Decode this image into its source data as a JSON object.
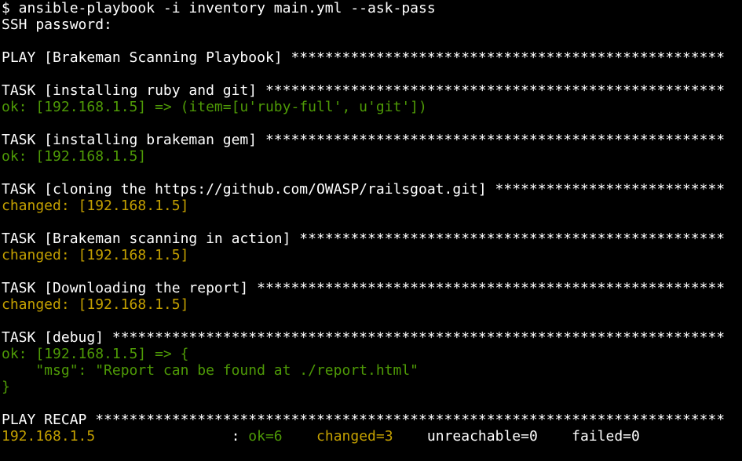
{
  "colors": {
    "background": "#000000",
    "default_text": "#ffffff",
    "ok": "#4e9a06",
    "changed": "#c4a000"
  },
  "terminal": {
    "lines": [
      {
        "segments": [
          {
            "text": "$ ansible-playbook -i inventory main.yml --ask-pass",
            "color": "white"
          }
        ]
      },
      {
        "segments": [
          {
            "text": "SSH password:",
            "color": "white"
          }
        ]
      },
      {
        "segments": []
      },
      {
        "segments": [
          {
            "text": "PLAY [Brakeman Scanning Playbook] ***************************************************",
            "color": "white"
          }
        ]
      },
      {
        "segments": []
      },
      {
        "segments": [
          {
            "text": "TASK [installing ruby and git] ******************************************************",
            "color": "white"
          }
        ]
      },
      {
        "segments": [
          {
            "text": "ok: [192.168.1.5] => (item=[u'ruby-full', u'git'])",
            "color": "green"
          }
        ]
      },
      {
        "segments": []
      },
      {
        "segments": [
          {
            "text": "TASK [installing brakeman gem] ******************************************************",
            "color": "white"
          }
        ]
      },
      {
        "segments": [
          {
            "text": "ok: [192.168.1.5]",
            "color": "green"
          }
        ]
      },
      {
        "segments": []
      },
      {
        "segments": [
          {
            "text": "TASK [cloning the https://github.com/OWASP/railsgoat.git] ***************************",
            "color": "white"
          }
        ]
      },
      {
        "segments": [
          {
            "text": "changed: [192.168.1.5]",
            "color": "yellow"
          }
        ]
      },
      {
        "segments": []
      },
      {
        "segments": [
          {
            "text": "TASK [Brakeman scanning in action] **************************************************",
            "color": "white"
          }
        ]
      },
      {
        "segments": [
          {
            "text": "changed: [192.168.1.5]",
            "color": "yellow"
          }
        ]
      },
      {
        "segments": []
      },
      {
        "segments": [
          {
            "text": "TASK [Downloading the report] *******************************************************",
            "color": "white"
          }
        ]
      },
      {
        "segments": [
          {
            "text": "changed: [192.168.1.5]",
            "color": "yellow"
          }
        ]
      },
      {
        "segments": []
      },
      {
        "segments": [
          {
            "text": "TASK [debug] ************************************************************************",
            "color": "white"
          }
        ]
      },
      {
        "segments": [
          {
            "text": "ok: [192.168.1.5] => {",
            "color": "green"
          }
        ]
      },
      {
        "segments": [
          {
            "text": "    \"msg\": \"Report can be found at ./report.html\"",
            "color": "green"
          }
        ]
      },
      {
        "segments": [
          {
            "text": "}",
            "color": "green"
          }
        ]
      },
      {
        "segments": []
      },
      {
        "segments": [
          {
            "text": "PLAY RECAP **************************************************************************",
            "color": "white"
          }
        ]
      },
      {
        "segments": [
          {
            "text": "192.168.1.5",
            "color": "yellow"
          },
          {
            "text": "                : ",
            "color": "white"
          },
          {
            "text": "ok=6",
            "color": "green"
          },
          {
            "text": "    ",
            "color": "white"
          },
          {
            "text": "changed=3",
            "color": "yellow"
          },
          {
            "text": "    unreachable=0    failed=0",
            "color": "white"
          }
        ]
      }
    ]
  }
}
